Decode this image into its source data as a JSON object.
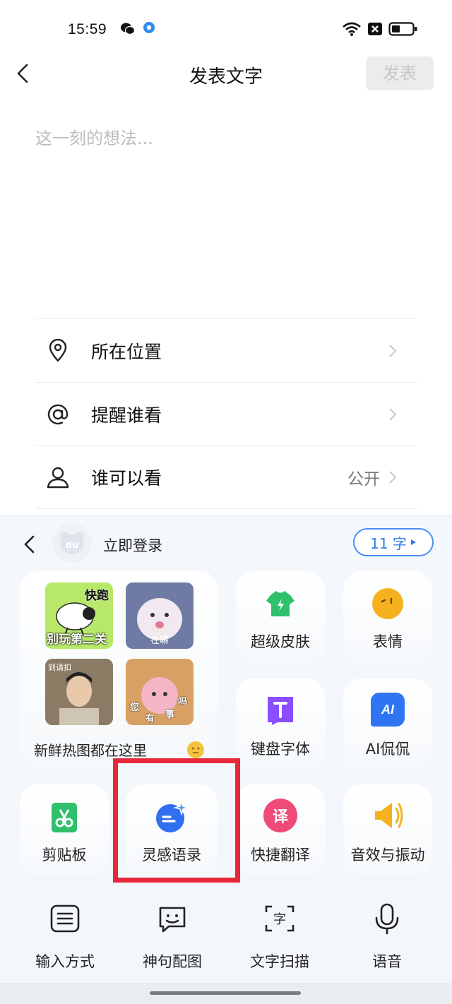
{
  "status_bar": {
    "time": "15:59"
  },
  "header": {
    "title": "发表文字",
    "publish_label": "发表"
  },
  "post": {
    "placeholder": "这一刻的想法..."
  },
  "options": [
    {
      "label": "所在位置",
      "value": "",
      "icon": "location-icon"
    },
    {
      "label": "提醒谁看",
      "value": "",
      "icon": "at-icon"
    },
    {
      "label": "谁可以看",
      "value": "公开",
      "icon": "person-icon"
    }
  ],
  "keyboard": {
    "login_text": "立即登录",
    "word_count": "11 字",
    "avatar_text": "du",
    "sticker_card": {
      "label": "新鲜热图都在这里",
      "stickers": [
        {
          "caption_top": "快跑",
          "caption_bottom": "别玩第二关"
        },
        {
          "caption_bottom": "在嘛"
        },
        {
          "caption_top": "到请扣"
        },
        {
          "caption_chars": [
            "您",
            "有",
            "事",
            "吗"
          ]
        }
      ]
    },
    "tiles": {
      "skin": "超级皮肤",
      "emoji": "表情",
      "font": "键盘字体",
      "ai": "AI侃侃",
      "ai_badge": "AI",
      "clipboard": "剪贴板",
      "inspiration": "灵感语录",
      "translate": "快捷翻译",
      "translate_badge": "译",
      "sound": "音效与振动"
    },
    "bottom_bar": [
      {
        "label": "输入方式",
        "icon": "keyboard-icon"
      },
      {
        "label": "神句配图",
        "icon": "smile-chat-icon"
      },
      {
        "label": "文字扫描",
        "icon": "text-scan-icon"
      },
      {
        "label": "语音",
        "icon": "microphone-icon"
      }
    ]
  },
  "colors": {
    "accent_blue": "#2e7cf0",
    "highlight_red": "#e7283a",
    "green": "#2fc06b",
    "orange": "#f5b21e",
    "purple": "#7c4dff"
  }
}
